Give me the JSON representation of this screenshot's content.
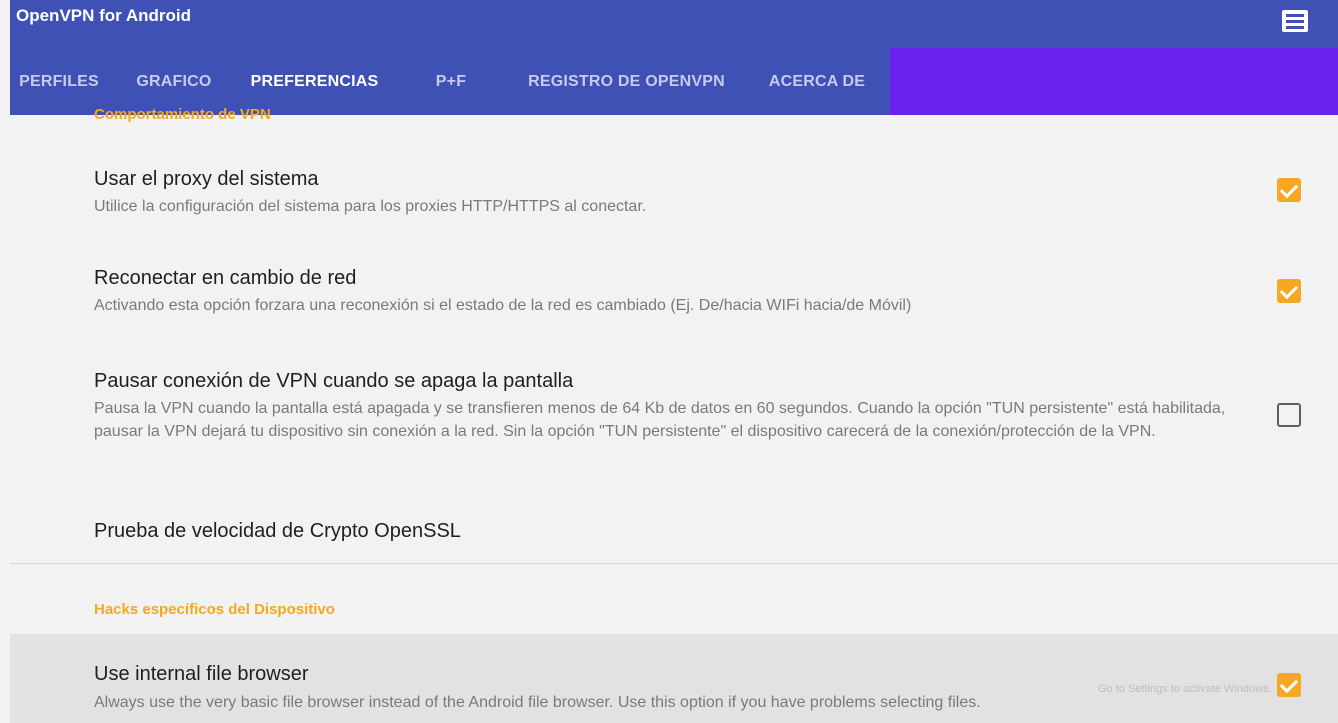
{
  "app": {
    "title": "OpenVPN for Android",
    "menu_icon": "overflow-menu-icon"
  },
  "tabs": [
    {
      "label": "PERFILES",
      "active": false
    },
    {
      "label": "GRAFICO",
      "active": false
    },
    {
      "label": "PREFERENCIAS",
      "active": true
    },
    {
      "label": "P+F",
      "active": false
    },
    {
      "label": "REGISTRO DE OPENVPN",
      "active": false
    },
    {
      "label": "ACERCA DE",
      "active": false
    }
  ],
  "colors": {
    "appbar": "#3f51b5",
    "tab_extension": "#6b22f0",
    "accent": "#f6a823",
    "section_header": "#f4a81d"
  },
  "content": {
    "partial_section_header": "Comportamiento de VPN",
    "prefs": [
      {
        "title": "Usar el proxy del sistema",
        "summary": "Utilice la configuración del sistema para los proxies HTTP/HTTPS al conectar.",
        "checked": true
      },
      {
        "title": "Reconectar en cambio de red",
        "summary": "Activando esta opción forzara una reconexión si el estado de la red es cambiado (Ej. De/hacia WIFi hacia/de Móvil)",
        "checked": true
      },
      {
        "title": "Pausar conexión de VPN cuando se apaga la pantalla",
        "summary": "Pausa la VPN cuando la pantalla está apagada y se transfieren menos de 64 Kb de datos en 60 segundos. Cuando la opción \"TUN persistente\" está habilitada, pausar la VPN dejará tu dispositivo sin conexión a la red. Sin la opción \"TUN persistente\" el dispositivo carecerá de la conexión/protección de la VPN.",
        "checked": false
      },
      {
        "title": "Prueba de velocidad de Crypto OpenSSL"
      }
    ],
    "section_header": "Hacks específicos del Dispositivo",
    "device_pref": {
      "title": "Use internal file browser",
      "summary": "Always use the very basic file browser instead of the Android file browser. Use this option if you have problems selecting files.",
      "checked": true
    }
  },
  "watermark": "Go to Settings to activate Windows."
}
